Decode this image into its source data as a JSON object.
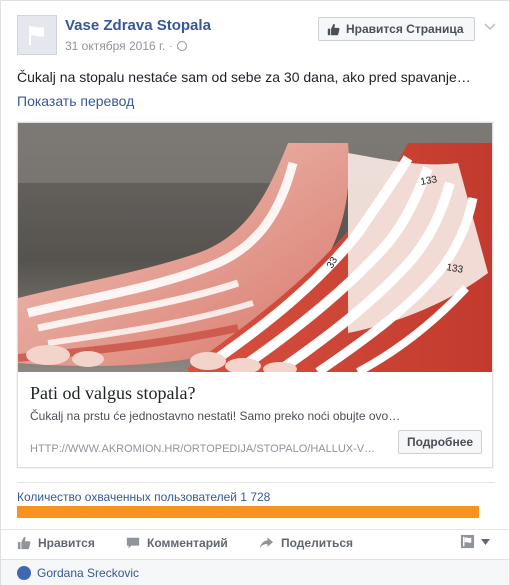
{
  "header": {
    "page_name": "Vase Zdrava Stopala",
    "date": "31 октября 2016 г.",
    "separator": "·",
    "like_page_label": "Нравится Страница"
  },
  "post": {
    "text": "Čukalj na stopalu nestaće sam od sebe za 30 dana, ako pred spavanje…",
    "translate_label": "Показать перевод"
  },
  "link_preview": {
    "title": "Pati od valgus stopala?",
    "description": "Čukalj na prstu će jednostavno nestati! Samo preko noći obujte ovo…",
    "url": "HTTP://WWW.AKROMION.HR/ORTOPEDIJA/STOPALO/HALLUX-V…",
    "more_button": "Подробнее",
    "image_labels": [
      "133",
      "33",
      "133"
    ]
  },
  "reach": {
    "label": "Количество охваченных пользователей 1 728",
    "progress_fraction": 1.0
  },
  "actions": {
    "like": "Нравится",
    "comment": "Комментарий",
    "share": "Поделиться"
  },
  "commenter": {
    "name": "Gordana Sreckovic"
  },
  "colors": {
    "link_blue": "#365899",
    "reach_orange": "#f7931e",
    "action_gray": "#616770"
  }
}
